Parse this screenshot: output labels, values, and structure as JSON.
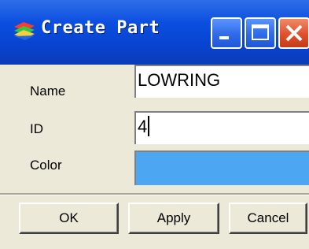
{
  "window": {
    "title": "Create Part",
    "icon": "part-stack-icon",
    "controls": [
      "minimize-icon",
      "maximize-icon",
      "close-icon"
    ]
  },
  "form": {
    "name_label": "Name",
    "name_value": "LOWRING",
    "id_label": "ID",
    "id_value": "4",
    "color_label": "Color",
    "color_value": "#4da6f2"
  },
  "buttons": {
    "ok": "OK",
    "apply": "Apply",
    "cancel": "Cancel"
  },
  "colors": {
    "titlebar": "#0b4fe0",
    "dialog_bg": "#ece9d8",
    "close_button": "#e0502a"
  }
}
